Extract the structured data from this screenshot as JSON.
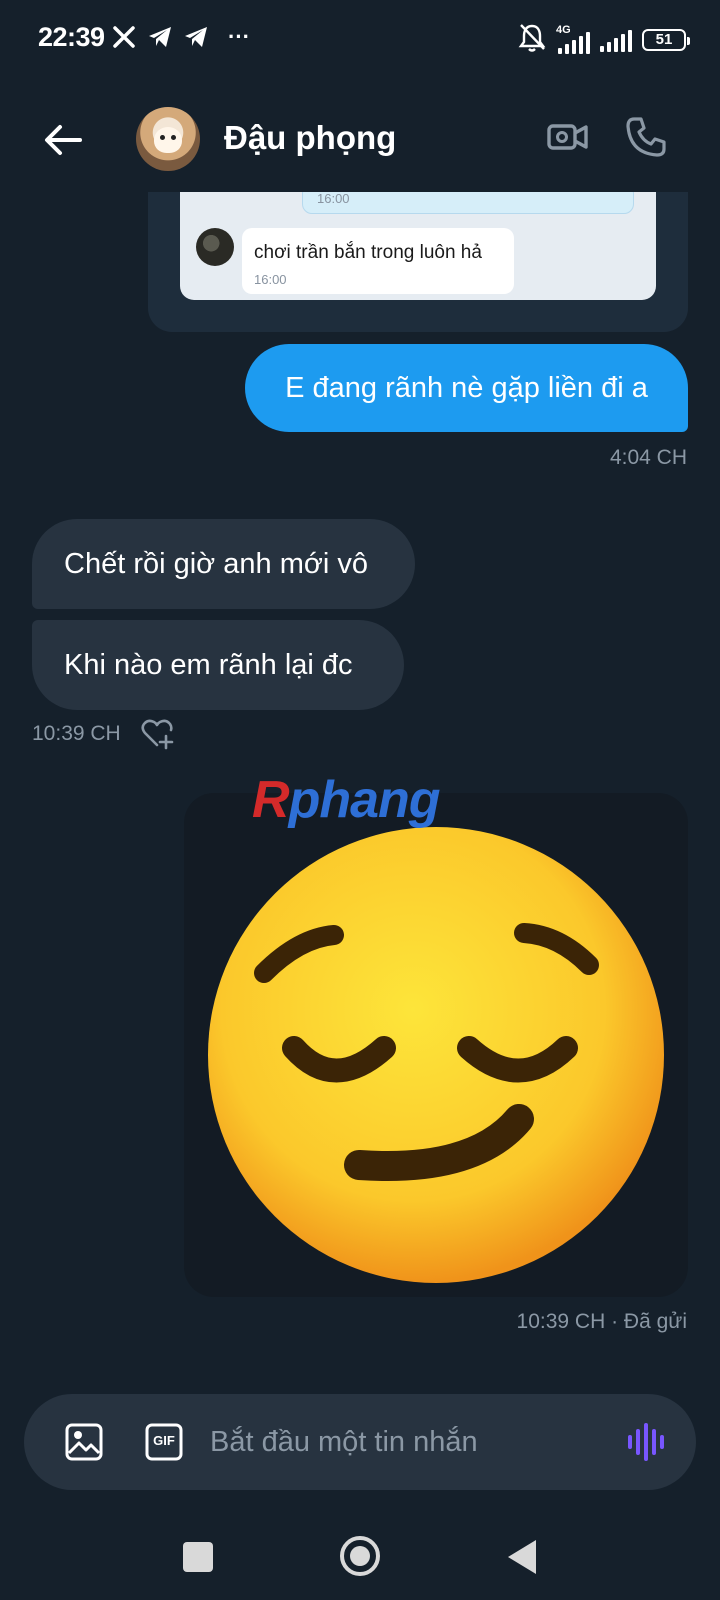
{
  "status_bar": {
    "time": "22:39",
    "network": "4G",
    "battery": "51",
    "more": "···"
  },
  "header": {
    "contact_name": "Đậu phọng"
  },
  "shared_image": {
    "top_time": "16:00",
    "message_text": "chơi trần bắn trong luôn hả",
    "message_time": "16:00"
  },
  "messages": {
    "sent_1": {
      "text": "E đang rãnh nè gặp liền đi a",
      "time": "4:04 CH"
    },
    "received": [
      {
        "text": "Chết rồi giờ anh mới vô"
      },
      {
        "text": "Khi nào em rãnh lại đc"
      }
    ],
    "received_time": "10:39 CH",
    "sent_2": {
      "time": "10:39 CH · Đã gửi"
    }
  },
  "watermark": {
    "part1": "R",
    "part2": "phang"
  },
  "composer": {
    "placeholder": "Bắt đầu một tin nhắn",
    "gif_label": "GIF"
  },
  "colors": {
    "background": "#15202b",
    "sent_bubble": "#1d9bf0",
    "received_bubble": "#273340",
    "muted_text": "#8b98a5",
    "voice_accent": "#7856ff"
  }
}
